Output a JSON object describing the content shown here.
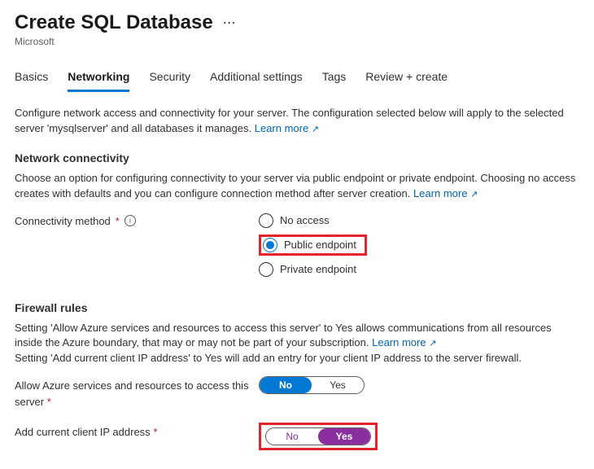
{
  "header": {
    "title": "Create SQL Database",
    "subtitle": "Microsoft"
  },
  "tabs": {
    "basics": "Basics",
    "networking": "Networking",
    "security": "Security",
    "additional": "Additional settings",
    "tags": "Tags",
    "review": "Review + create"
  },
  "intro": {
    "text_a": "Configure network access and connectivity for your server. The configuration selected below will apply to the selected server 'mysqlserver' and all databases it manages. ",
    "learn_more": "Learn more"
  },
  "connectivity": {
    "heading": "Network connectivity",
    "desc_a": "Choose an option for configuring connectivity to your server via public endpoint or private endpoint. Choosing no access creates with defaults and you can configure connection method after server creation. ",
    "learn_more": "Learn more",
    "label": "Connectivity method",
    "options": {
      "no_access": "No access",
      "public": "Public endpoint",
      "private": "Private endpoint"
    }
  },
  "firewall": {
    "heading": "Firewall rules",
    "desc_a": "Setting 'Allow Azure services and resources to access this server' to Yes allows communications from all resources inside the Azure boundary, that may or may not be part of your subscription. ",
    "learn_more": "Learn more",
    "desc_b": "Setting 'Add current client IP address' to Yes will add an entry for your client IP address to the server firewall.",
    "allow_label": "Allow Azure services and resources to access this server",
    "clientip_label": "Add current client IP address",
    "no": "No",
    "yes": "Yes"
  }
}
